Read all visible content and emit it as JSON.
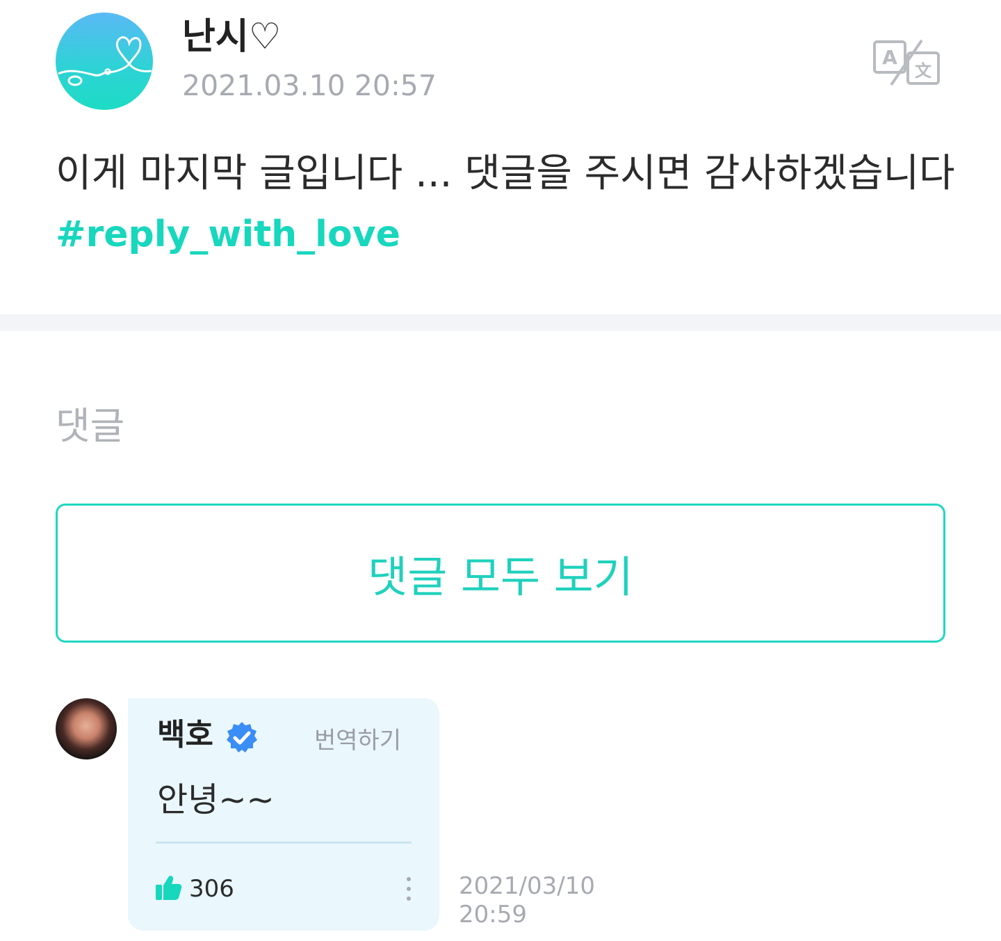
{
  "post": {
    "author": "난시",
    "author_symbol": "♡",
    "date": "2021.03.10 20:57",
    "text": "이게 마지막 글입니다 ... 댓글을 주시면 감사하겠습니다",
    "hashtag": "#reply_with_love",
    "translate_icon": "translate-icon",
    "avatar_icon": "heart-logo-icon"
  },
  "comments_section": {
    "heading": "댓글",
    "view_all_label": "댓글 모두 보기"
  },
  "comment": {
    "author": "백호",
    "verified_icon": "verified-badge-icon",
    "translate_label": "번역하기",
    "text": "안녕~~",
    "like_icon": "thumbs-up-icon",
    "like_count": "306",
    "more_icon": "more-vertical-icon",
    "date": "2021/03/10",
    "time": "20:59"
  },
  "colors": {
    "accent": "#1fd8bf",
    "muted_text": "#a7aab0",
    "bubble_bg": "#eaf7fd",
    "verified": "#3a8ef6",
    "divider": "#f3f4f7"
  }
}
